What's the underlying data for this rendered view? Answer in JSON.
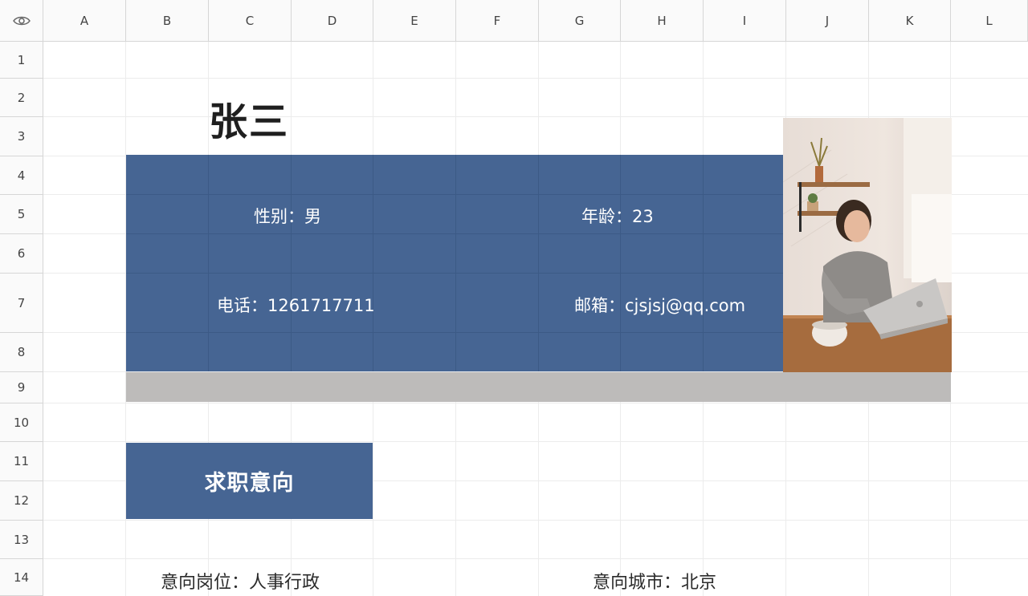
{
  "columns": [
    "A",
    "B",
    "C",
    "D",
    "E",
    "F",
    "G",
    "H",
    "I",
    "J",
    "K",
    "L"
  ],
  "rows": [
    "1",
    "2",
    "3",
    "4",
    "5",
    "6",
    "7",
    "8",
    "9",
    "10",
    "11",
    "12",
    "13",
    "14"
  ],
  "resume": {
    "name": "张三",
    "gender": "性别：男",
    "age": "年龄：23",
    "phone": "电话：1261717711",
    "email": "邮箱：cjsjsj@qq.com",
    "section_title": "求职意向",
    "position": "意向岗位：人事行政",
    "city": "意向城市：北京"
  },
  "icons": {
    "corner": "eye-icon"
  },
  "colors": {
    "panel": "#466593",
    "divider_bar": "#bdbbba"
  }
}
